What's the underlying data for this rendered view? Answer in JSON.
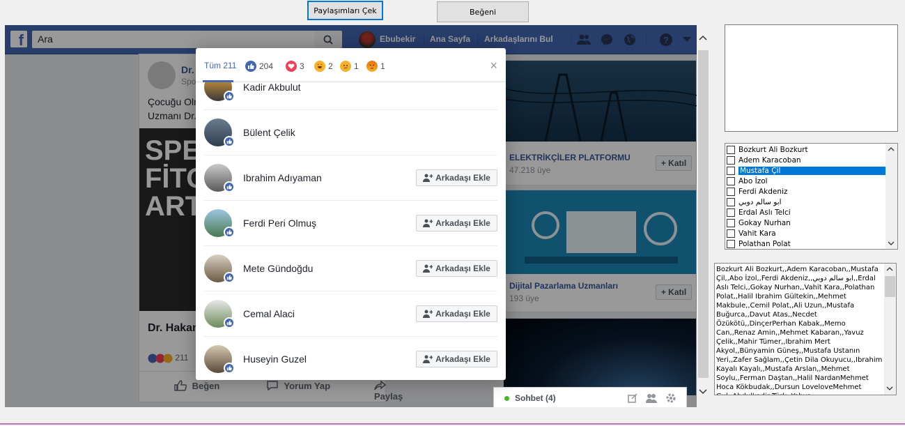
{
  "form": {
    "fetch_button": "Paylaşımları Çek",
    "like_button": "Beğeni"
  },
  "fb": {
    "search_placeholder": "Ara",
    "user_name": "Ebubekir",
    "nav_home": "Ana Sayfa",
    "nav_find_friends": "Arkadaşlarını Bul"
  },
  "post": {
    "author": "Dr.",
    "sub": "Spo",
    "text_line1": "Çocuğu Olm",
    "text_line2": "Uzmanı Dr.",
    "image_text": "SPER\nFİTOT\nARTI",
    "footer_name": "Dr. Hakan",
    "reaction_count": "211",
    "action_like": "Beğen",
    "action_comment": "Yorum Yap",
    "action_share": "Paylaş"
  },
  "pages": [
    {
      "name": "ELEKTRİKÇİLER PLATFORMU",
      "members": "47.218 üye",
      "join": "+ Katıl"
    },
    {
      "name": "Dijital Pazarlama Uzmanları",
      "members": "193 üye",
      "join": "+ Katıl"
    }
  ],
  "chat": {
    "label": "Sohbet (4)"
  },
  "dialog": {
    "tab_all": "Tüm 211",
    "tabs": [
      {
        "icon": "like-icon",
        "count": "204",
        "color": "#4267b2"
      },
      {
        "icon": "love-icon",
        "count": "3",
        "color": "#f33e58"
      },
      {
        "icon": "haha-icon",
        "count": "2",
        "color": "#f7b125"
      },
      {
        "icon": "sad-icon",
        "count": "1",
        "color": "#f7b125"
      },
      {
        "icon": "angry-icon",
        "count": "1",
        "color": "#e9710f"
      }
    ],
    "close": "×",
    "people": [
      {
        "name": "Kadir Akbulut",
        "button": ""
      },
      {
        "name": "Bülent Çelik",
        "button": ""
      },
      {
        "name": "Ibrahim Adıyaman",
        "button": "Arkadaşı Ekle"
      },
      {
        "name": "Ferdi Peri Olmuş",
        "button": "Arkadaşı Ekle"
      },
      {
        "name": "Mete Gündoğdu",
        "button": "Arkadaşı Ekle"
      },
      {
        "name": "Cemal Alaci",
        "button": "Arkadaşı Ekle"
      },
      {
        "name": "Huseyin Guzel",
        "button": "Arkadaşı Ekle"
      }
    ]
  },
  "checklist": {
    "items": [
      "Bozkurt Ali Bozkurt",
      "Adem Karacoban",
      "Mustafa Çil",
      "Abo İzol",
      "Ferdi Akdeniz",
      "ابو سالم دوبي",
      "Erdal Aslı Telci",
      "Gokay Nurhan",
      "Vahit Kara",
      "Polathan Polat"
    ],
    "selected_index": 2
  },
  "memo": {
    "text": "Bozkurt Ali Bozkurt,,Adem Karacoban,,Mustafa Çil,,Abo İzol,,Ferdi Akdeniz,,ابو سالم دوبي,,Erdal Aslı Telci,,Gokay Nurhan,,Vahit Kara,,Polathan Polat,,Halil Ibrahim Gültekin,,Mehmet Makbule,,Cemil Polat,,Ali Uzun,,Mustafa Buğurca,,Davut Atas,,Necdet Özükötü,,DinçerPerhan Kabak,,Memo Can,,Renaz Amin,,Mehmet Kabaran,,Yavuz Çelik,,Mahir Tümer,,Ibrahim Mert Akyol,,Bünyamin Güneş,,Mustafa Ustanın Yeri,,Zafer Sağlam,,Çetin Dila Okuyucu,,Ibrahim Kayalı Kayalı,,Mustafa Arslan,,Mehmet Soylu,,Ferman Daştan,,Halil NardanMehmet Hoca Kökbudak,,Dursun LoveloveMehmet Gul,,Abdulkadir Türk,,Yahya"
  }
}
